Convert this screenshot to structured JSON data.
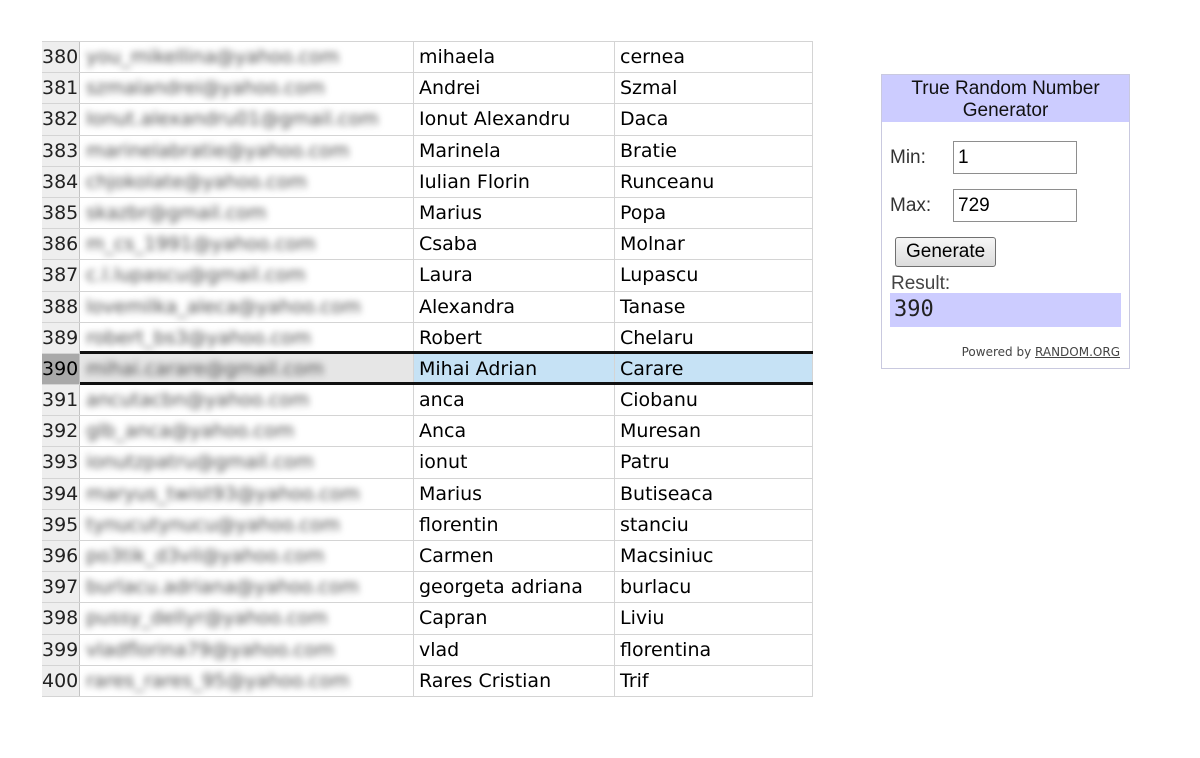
{
  "table": {
    "selected_row": "390",
    "rows": [
      {
        "num": "380",
        "email": "you_mikellina@yahoo.com",
        "first": "mihaela",
        "last": "cernea"
      },
      {
        "num": "381",
        "email": "szmalandrei@yahoo.com",
        "first": "Andrei",
        "last": "Szmal"
      },
      {
        "num": "382",
        "email": "Ionut.alexandru01@gmail.com",
        "first": "Ionut Alexandru",
        "last": "Daca"
      },
      {
        "num": "383",
        "email": "marinelabratie@yahoo.com",
        "first": "Marinela",
        "last": "Bratie"
      },
      {
        "num": "384",
        "email": "chjokolate@yahoo.com",
        "first": "Iulian Florin",
        "last": "Runceanu"
      },
      {
        "num": "385",
        "email": "skazbr@gmail.com",
        "first": "Marius",
        "last": "Popa"
      },
      {
        "num": "386",
        "email": "m_cs_1991@yahoo.com",
        "first": "Csaba",
        "last": "Molnar"
      },
      {
        "num": "387",
        "email": "c.l.lupascu@gmail.com",
        "first": "Laura",
        "last": "Lupascu"
      },
      {
        "num": "388",
        "email": "lovemilka_aleca@yahoo.com",
        "first": "Alexandra",
        "last": "Tanase"
      },
      {
        "num": "389",
        "email": "robert_bs3@yahoo.com",
        "first": "Robert",
        "last": "Chelaru"
      },
      {
        "num": "390",
        "email": "mihai.carare@gmail.com",
        "first": "Mihai Adrian",
        "last": "Carare"
      },
      {
        "num": "391",
        "email": "ancutacbn@yahoo.com",
        "first": "anca",
        "last": "Ciobanu"
      },
      {
        "num": "392",
        "email": "glb_anca@yahoo.com",
        "first": "Anca",
        "last": "Muresan"
      },
      {
        "num": "393",
        "email": "ionutzpatru@gmail.com",
        "first": "ionut",
        "last": "Patru"
      },
      {
        "num": "394",
        "email": "maryus_twist93@yahoo.com",
        "first": "Marius",
        "last": "Butiseaca"
      },
      {
        "num": "395",
        "email": "tynucutynucu@yahoo.com",
        "first": "florentin",
        "last": "stanciu"
      },
      {
        "num": "396",
        "email": "po3tik_d3vil@yahoo.com",
        "first": "Carmen",
        "last": "Macsiniuc"
      },
      {
        "num": "397",
        "email": "burlacu.adriana@yahoo.com",
        "first": "georgeta adriana",
        "last": "burlacu"
      },
      {
        "num": "398",
        "email": "pussy_dellyr@yahoo.com",
        "first": "Capran",
        "last": "Liviu"
      },
      {
        "num": "399",
        "email": "vladflorina79@yahoo.com",
        "first": "vlad",
        "last": "florentina"
      },
      {
        "num": "400",
        "email": "rares_rares_95@yahoo.com",
        "first": "Rares Cristian",
        "last": "Trif"
      }
    ]
  },
  "widget": {
    "title": "True Random Number Generator",
    "min_label": "Min:",
    "min_value": "1",
    "max_label": "Max:",
    "max_value": "729",
    "generate_label": "Generate",
    "result_label": "Result:",
    "result_value": "390",
    "powered_prefix": "Powered by",
    "powered_link": "RANDOM.ORG"
  }
}
